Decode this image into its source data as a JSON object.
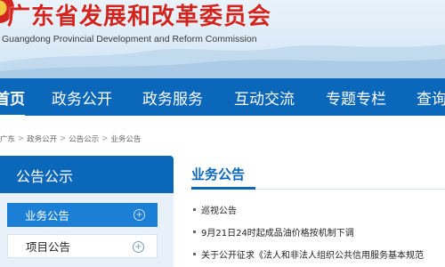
{
  "header": {
    "title": "广东省发展和改革委员会",
    "subtitle": "Guangdong Provincial Development and Reform Commission"
  },
  "nav": {
    "items": [
      "首页",
      "政务公开",
      "政务服务",
      "互动交流",
      "专题专栏",
      "查询"
    ]
  },
  "breadcrumb": {
    "items": [
      "广东",
      "政务公开",
      "公告公示",
      "业务公告"
    ],
    "separator": ">"
  },
  "sidebar": {
    "title": "公告公示",
    "items": [
      {
        "label": "业务公告",
        "active": true
      },
      {
        "label": "项目公告",
        "active": false
      }
    ]
  },
  "main": {
    "section_title": "业务公告",
    "news": [
      "巡视公告",
      "9月21日24时起成品油价格按机制下调",
      "关于公开征求《法人和非法人组织公共信用服务基本规范"
    ]
  },
  "colors": {
    "brand_red": "#d3251f",
    "nav_blue": "#0b67b9",
    "active_item_blue": "#1c7fd6",
    "sidebar_bg": "#e8f1fa"
  },
  "icons": {
    "sidebar_item": "plus-circle-icon",
    "emblem": "emblem-icon"
  }
}
